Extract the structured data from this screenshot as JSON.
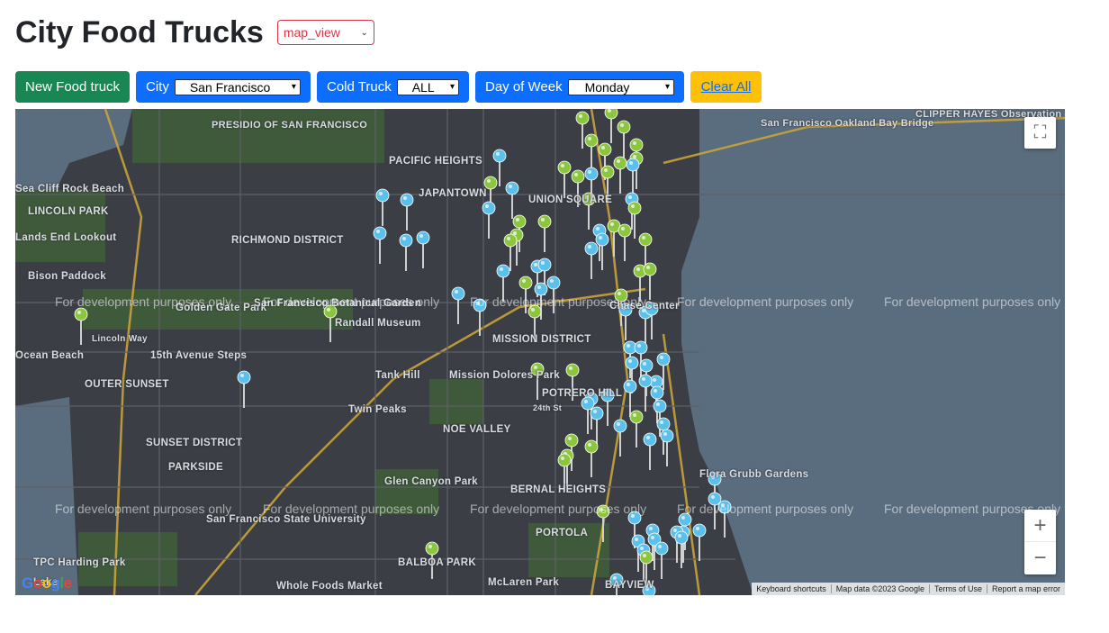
{
  "header": {
    "title": "City Food Trucks",
    "view_select": "map_view"
  },
  "toolbar": {
    "new_button": "New Food truck",
    "city_label": "City",
    "city_value": "San Francisco",
    "cold_label": "Cold Truck",
    "cold_value": "ALL",
    "day_label": "Day of Week",
    "day_value": "Monday",
    "clear_label": "Clear All"
  },
  "map": {
    "watermark": "For development purposes only",
    "labels": [
      "PRESIDIO OF SAN FRANCISCO",
      "PACIFIC HEIGHTS",
      "JAPANTOWN",
      "UNION SQUARE",
      "San Francisco Oakland Bay Bridge",
      "CLIPPER HAYES Observation Tower",
      "LINCOLN PARK",
      "RICHMOND DISTRICT",
      "Lands End Lookout",
      "Sea Cliff Rock Beach",
      "Bison Paddock",
      "Golden Gate Park",
      "San Francisco Botanical Garden",
      "Randall Museum",
      "MISSION DISTRICT",
      "Mission Dolores Park",
      "POTRERO HILL",
      "OUTER SUNSET",
      "15th Avenue Steps",
      "Tank Hill",
      "Twin Peaks",
      "NOE VALLEY",
      "SUNSET DISTRICT",
      "PARKSIDE",
      "Glen Canyon Park",
      "BERNAL HEIGHTS",
      "PORTOLA",
      "San Francisco State University",
      "TPC Harding Park",
      "BALBOA PARK",
      "McLaren Park",
      "Whole Foods Market",
      "Flora Grubb Gardens",
      "BAYVIEW",
      "Lake",
      "Lincoln Way",
      "Ocean Beach",
      "24th St",
      "Chase Center"
    ],
    "attribution": {
      "shortcuts": "Keyboard shortcuts",
      "data": "Map data ©2023 Google",
      "terms": "Terms of Use",
      "report": "Report a map error",
      "logo": "Google"
    },
    "controls": {
      "fullscreen_icon": "fullscreen-icon",
      "zoom_in": "+",
      "zoom_out": "−"
    },
    "colors": {
      "green_pin": "#8cc63f",
      "blue_pin": "#5bc0eb",
      "water": "#5a6d7e",
      "land": "#3b3f45",
      "park": "#3f5a3a"
    }
  }
}
